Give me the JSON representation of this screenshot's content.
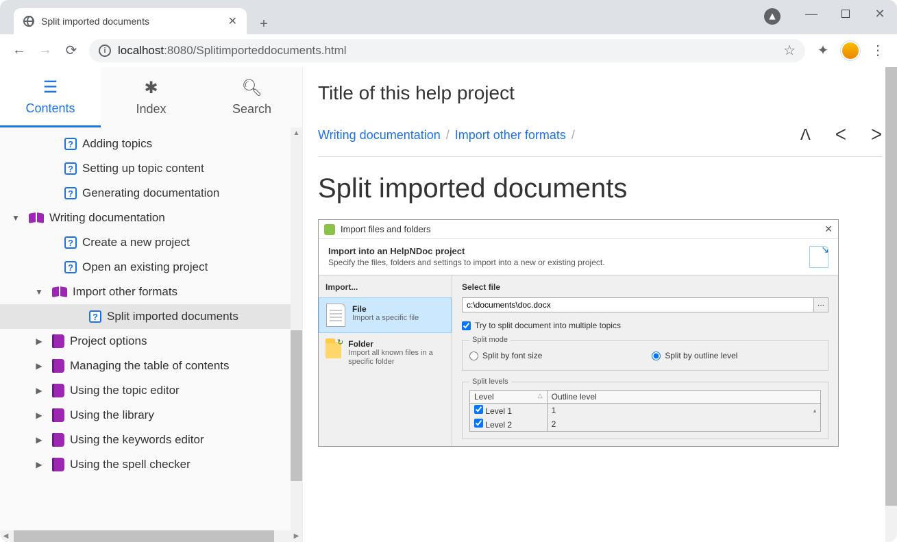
{
  "browser": {
    "tab_title": "Split imported documents",
    "new_tab": "+",
    "url_prefix": "localhost",
    "url_port": ":8080",
    "url_path": "/Splitimporteddocuments.html"
  },
  "side_tabs": {
    "contents": "Contents",
    "index": "Index",
    "search": "Search"
  },
  "tree": {
    "adding_topics": "Adding topics",
    "setting_up": "Setting up topic content",
    "generating": "Generating documentation",
    "writing_doc": "Writing documentation",
    "create_proj": "Create a new project",
    "open_proj": "Open an existing project",
    "import_other": "Import other formats",
    "split_imported": "Split imported documents",
    "project_options": "Project options",
    "managing_toc": "Managing the table of contents",
    "topic_editor": "Using the topic editor",
    "library": "Using the library",
    "keywords_editor": "Using the keywords editor",
    "spell_checker": "Using the spell checker"
  },
  "main": {
    "project_title": "Title of this help project",
    "crumb1": "Writing documentation",
    "crumb2": "Import other formats",
    "page_title": "Split imported documents"
  },
  "dialog": {
    "title": "Import files and folders",
    "head": "Import into an HelpNDoc project",
    "head_sub": "Specify the files, folders and settings to import into a new or existing project.",
    "import": "Import...",
    "file": "File",
    "file_sub": "Import a specific file",
    "folder": "Folder",
    "folder_sub": "Import all known files in a specific folder",
    "select_file": "Select file",
    "file_path": "c:\\documents\\doc.docx",
    "browse": "···",
    "try_split": "Try to split document into multiple topics",
    "split_mode": "Split mode",
    "by_font": "Split by font size",
    "by_outline": "Split by outline level",
    "split_levels": "Split levels",
    "col_level": "Level",
    "col_outline": "Outline level",
    "lvl1": "Level 1",
    "lvl1v": "1",
    "lvl2": "Level 2",
    "lvl2v": "2"
  }
}
